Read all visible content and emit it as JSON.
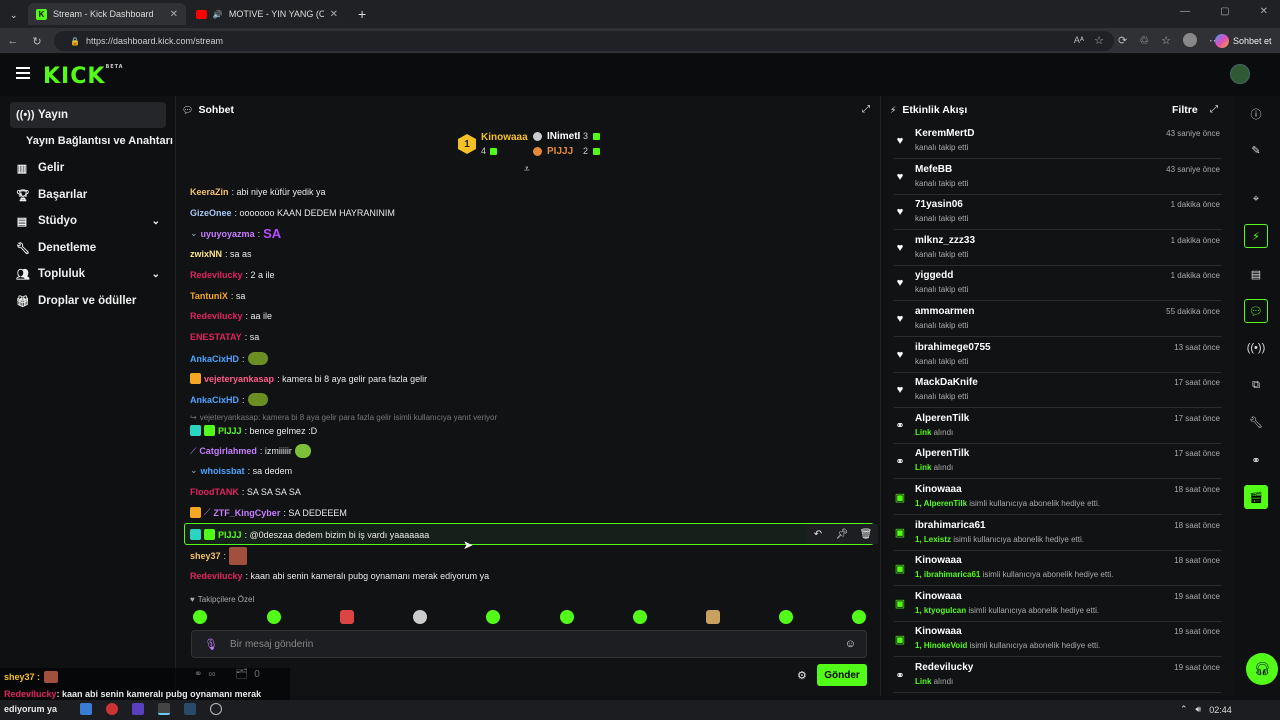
{
  "browser": {
    "tabs": [
      {
        "title": "Stream - Kick Dashboard"
      },
      {
        "title": "MOTIVE - YIN YANG (Official I"
      }
    ],
    "url": "https://dashboard.kick.com/stream",
    "profile_button": "Sohbet et",
    "read_aloud": "Aᴬ"
  },
  "header": {
    "logo": "KICK",
    "logo_tag": "BETA"
  },
  "sidebar": {
    "items": [
      {
        "label": "Yayın",
        "icon": "broadcast-icon"
      },
      {
        "label": "Yayın Bağlantısı ve Anahtarı"
      },
      {
        "label": "Gelir",
        "icon": "chart-icon"
      },
      {
        "label": "Başarılar",
        "icon": "trophy-icon"
      },
      {
        "label": "Stüdyo",
        "icon": "studio-icon"
      },
      {
        "label": "Denetleme",
        "icon": "wrench-icon"
      },
      {
        "label": "Topluluk",
        "icon": "community-icon"
      },
      {
        "label": "Droplar ve ödüller",
        "icon": "gift-icon"
      }
    ]
  },
  "chat": {
    "title": "Sohbet",
    "leaderboard": {
      "first": {
        "name": "Kinowaaa",
        "count": "4",
        "rank": "1"
      },
      "second": {
        "name": "INimetI",
        "count": "3"
      },
      "third": {
        "name": "PIJJJ",
        "count": "2"
      }
    },
    "messages": [
      {
        "user": "KeeraZin",
        "text": ": abi niye küfür yedik ya",
        "color": "#f5c26b"
      },
      {
        "user": "GizeOnee",
        "text": ": ooooooo KAAN DEDEM HAYRANINIM",
        "color": "#a7c7f2"
      },
      {
        "user": "uyuyoyazma",
        "text": ":",
        "color": "#c77dff",
        "extra": "SA"
      },
      {
        "user": "zwixNN",
        "text": ": sa as",
        "color": "#ffe38a"
      },
      {
        "user": "Redevilucky",
        "text": ": 2 a ile",
        "color": "#e0245e"
      },
      {
        "user": "TantuniX",
        "text": ": sa",
        "color": "#f5a623"
      },
      {
        "user": "Redevilucky",
        "text": ": aa ile",
        "color": "#e0245e"
      },
      {
        "user": "ENESTATAY",
        "text": ": sa",
        "color": "#e0245e"
      },
      {
        "user": "AnkaCixHD",
        "text": ":",
        "color": "#4aa3ff"
      },
      {
        "user": "vejeteryankasap",
        "text": ": kamera bi 8 aya gelir para fazla gelir",
        "color": "#ff5c8a"
      },
      {
        "user": "AnkaCixHD",
        "text": ":",
        "color": "#4aa3ff"
      },
      {
        "user": "PIJJJ",
        "text": ": bence gelmez :D",
        "color": "#53fc18"
      },
      {
        "user": "Catgirlahmed",
        "text": ": izmiiiiir",
        "color": "#c77dff"
      },
      {
        "user": "whoissbat",
        "text": ": sa dedem",
        "color": "#4aa3ff"
      },
      {
        "user": "FloodTANK",
        "text": ": SA SA SA SA",
        "color": "#e0245e"
      },
      {
        "user": "ZTF_KingCyber",
        "text": ": SA DEDEEEM",
        "color": "#c77dff"
      },
      {
        "user": "PIJJJ",
        "text": ": @0deszaa dedem bizim bi iş vardı yaaaaaaa",
        "color": "#53fc18"
      },
      {
        "user": "shey37",
        "text": ":",
        "color": "#f5c26b"
      },
      {
        "user": "Redevilucky",
        "text": ": kaan abi senin kameralı pubg oynamanı merak ediyorum ya",
        "color": "#e0245e"
      }
    ],
    "reply_note": "vejeteryankasap: kamera bi 8 aya gelir para fazla gelir isimli kullanıcıya yanıt veriyor",
    "followers_only": "Takipçilere Özel",
    "input_placeholder": "Bir mesaj gönderin",
    "stats": {
      "infinite": "∞",
      "count": "0"
    },
    "send_label": "Gönder"
  },
  "activity": {
    "title": "Etkinlik Akışı",
    "filter_label": "Filtre",
    "items": [
      {
        "name": "KeremMertD",
        "sub": "kanalı takip etti",
        "time": "43 saniye önce",
        "icon": "heart-icon"
      },
      {
        "name": "MefeBB",
        "sub": "kanalı takip etti",
        "time": "43 saniye önce",
        "icon": "heart-icon"
      },
      {
        "name": "71yasin06",
        "sub": "kanalı takip etti",
        "time": "1 dakika önce",
        "icon": "heart-icon"
      },
      {
        "name": "mlknz_zzz33",
        "sub": "kanalı takip etti",
        "time": "1 dakika önce",
        "icon": "heart-icon"
      },
      {
        "name": "yiggedd",
        "sub": "kanalı takip etti",
        "time": "1 dakika önce",
        "icon": "heart-icon"
      },
      {
        "name": "ammoarmen",
        "sub": "kanalı takip etti",
        "time": "55 dakika önce",
        "icon": "heart-icon"
      },
      {
        "name": "ibrahimege0755",
        "sub": "kanalı takip etti",
        "time": "13 saat önce",
        "icon": "heart-icon"
      },
      {
        "name": "MackDaKnife",
        "sub": "kanalı takip etti",
        "time": "17 saat önce",
        "icon": "heart-icon"
      },
      {
        "name": "AlperenTilk",
        "sub_hl": "Link",
        "sub": " alındı",
        "time": "17 saat önce",
        "icon": "share-icon"
      },
      {
        "name": "AlperenTilk",
        "sub_hl": "Link",
        "sub": " alındı",
        "time": "17 saat önce",
        "icon": "share-icon"
      },
      {
        "name": "Kinowaaa",
        "sub_hl": "1, AlperenTilk",
        "sub": " isimli kullanıcıya abonelik hediye etti.",
        "time": "18 saat önce",
        "icon": "gift-icon"
      },
      {
        "name": "ibrahimarica61",
        "sub_hl": "1, Lexistz",
        "sub": " isimli kullanıcıya abonelik hediye etti.",
        "time": "18 saat önce",
        "icon": "gift-icon"
      },
      {
        "name": "Kinowaaa",
        "sub_hl": "1, ibrahimarica61",
        "sub": " isimli kullanıcıya abonelik hediye etti.",
        "time": "18 saat önce",
        "icon": "gift-icon"
      },
      {
        "name": "Kinowaaa",
        "sub_hl": "1, ktyogulcan",
        "sub": " isimli kullanıcıya abonelik hediye etti.",
        "time": "19 saat önce",
        "icon": "gift-icon"
      },
      {
        "name": "Kinowaaa",
        "sub_hl": "1, HinokeVoid",
        "sub": " isimli kullanıcıya abonelik hediye etti.",
        "time": "19 saat önce",
        "icon": "gift-icon"
      },
      {
        "name": "Redevilucky",
        "sub_hl": "Link",
        "sub": " alındı",
        "time": "19 saat önce",
        "icon": "share-icon"
      }
    ]
  },
  "overlay": {
    "line1_user": "shey37 :",
    "line2_user": "Redevilucky",
    "line2_text": " : kaan abi senin kameralı pubg oynamanı merak",
    "line3_text": "ediyorum ya"
  },
  "taskbar": {
    "clock": "02:44"
  },
  "colors": {
    "accent": "#53fc18",
    "background": "#0f1012"
  }
}
